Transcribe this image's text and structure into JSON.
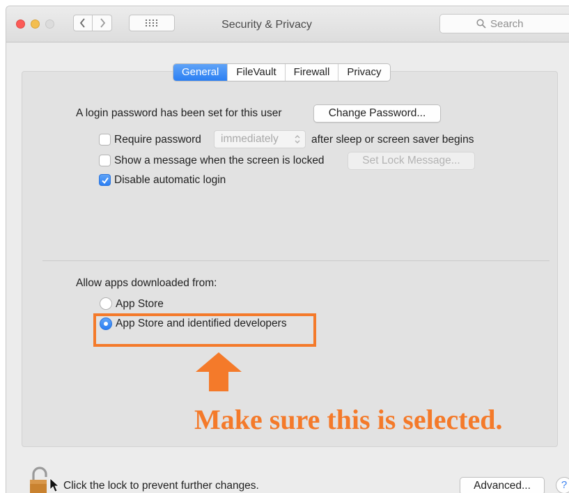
{
  "window": {
    "title": "Security & Privacy",
    "search_placeholder": "Search"
  },
  "tabs": [
    {
      "label": "General",
      "active": true
    },
    {
      "label": "FileVault",
      "active": false
    },
    {
      "label": "Firewall",
      "active": false
    },
    {
      "label": "Privacy",
      "active": false
    }
  ],
  "general": {
    "login_text": "A login password has been set for this user",
    "change_password_label": "Change Password...",
    "require_password": {
      "label": "Require password",
      "checked": false,
      "select_value": "immediately",
      "suffix": "after sleep or screen saver begins"
    },
    "show_message": {
      "label": "Show a message when the screen is locked",
      "checked": false,
      "button_label": "Set Lock Message..."
    },
    "disable_login": {
      "label": "Disable automatic login",
      "checked": true
    },
    "allow_apps": {
      "heading": "Allow apps downloaded from:",
      "options": [
        {
          "label": "App Store",
          "selected": false
        },
        {
          "label": "App Store and identified developers",
          "selected": true
        }
      ]
    }
  },
  "annotation": {
    "text": "Make sure this is selected.",
    "color": "#f47a2a"
  },
  "footer": {
    "lock_text": "Click the lock to prevent further changes.",
    "advanced_label": "Advanced...",
    "help_label": "?"
  },
  "colors": {
    "accent": "#2b7ff3",
    "close": "#fc5b57",
    "minimize": "#f3be4f"
  }
}
